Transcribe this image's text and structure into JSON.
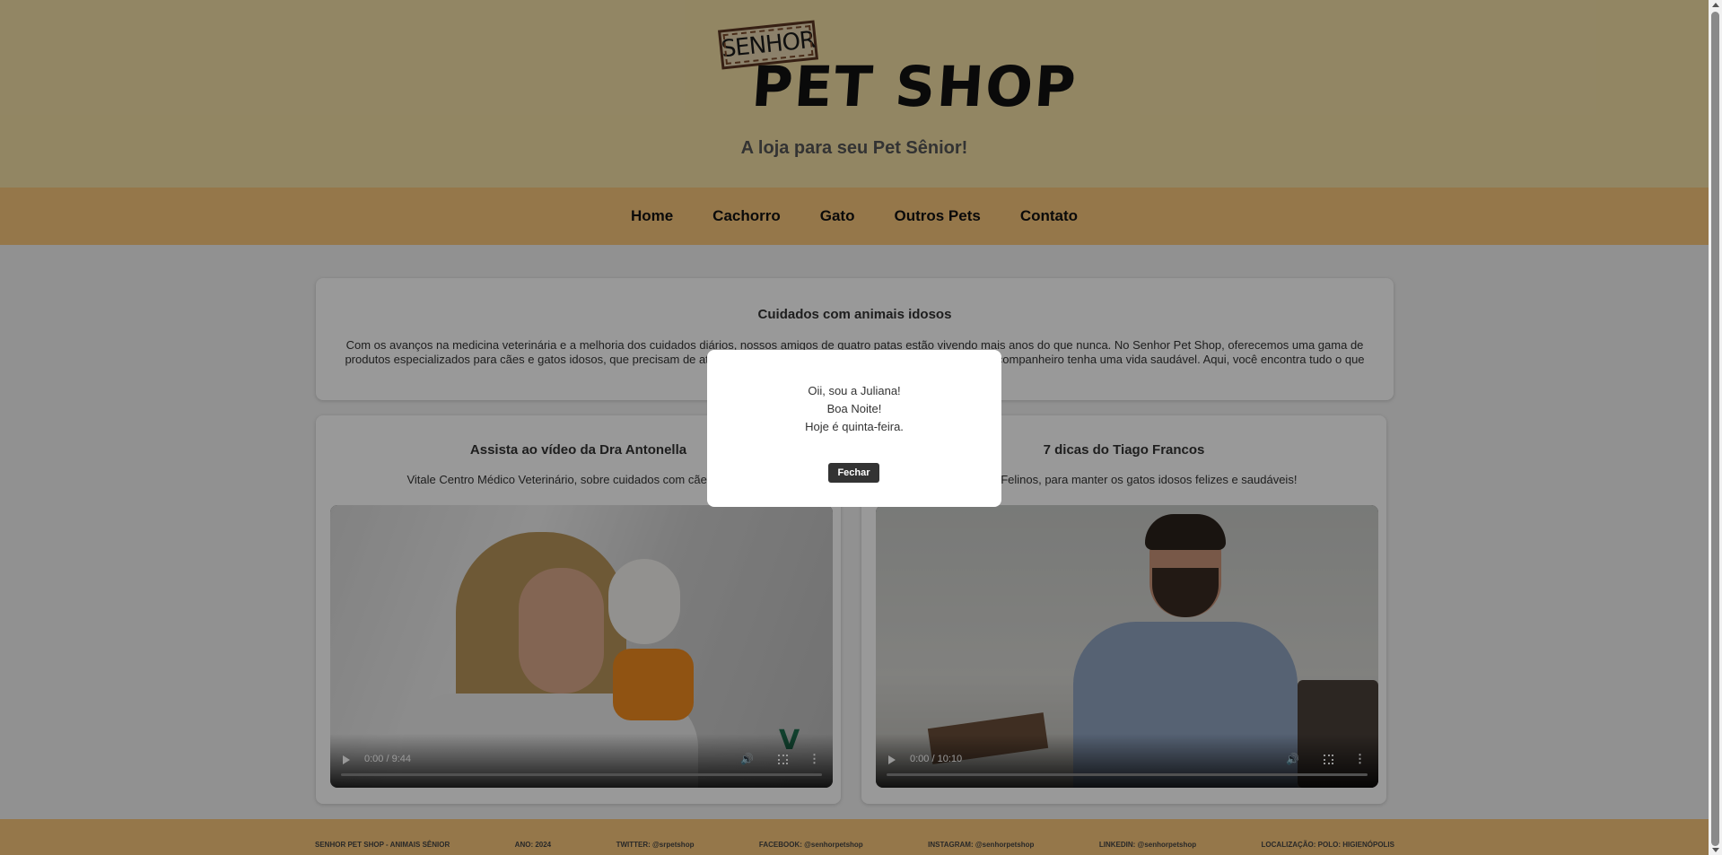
{
  "header": {
    "logo_small": "SENHOR",
    "logo_main": "PET SHOP",
    "tagline": "A loja para seu Pet Sênior!"
  },
  "nav": {
    "items": [
      "Home",
      "Cachorro",
      "Gato",
      "Outros Pets",
      "Contato"
    ]
  },
  "intro": {
    "title": "Cuidados com animais idosos",
    "text": "Com os avanços na medicina veterinária e a melhoria dos cuidados diários, nossos amigos de quatro patas estão vivendo mais anos do que nunca. No Senhor Pet Shop, oferecemos uma gama de produtos especializados para cães e gatos idosos, que precisam de atenção especial nessa fase da vida, garantindo que seu companheiro tenha uma vida saudável. Aqui, você encontra tudo o que seu pet sênior necessita para"
  },
  "videos": [
    {
      "title": "Assista ao vídeo da Dra Antonella",
      "subtitle": "Vitale Centro Médico Veterinário, sobre cuidados com cães idosos",
      "time": "0:00 / 9:44",
      "overlay_logo": "V"
    },
    {
      "title": "7 dicas do Tiago Francos",
      "subtitle": "Medicina Felinos, para manter os gatos idosos felizes e saudáveis!",
      "time": "0:00 / 10:10"
    }
  ],
  "footer": {
    "items": [
      "SENHOR PET SHOP - ANIMAIS SÊNIOR",
      "ANO: 2024",
      "TWITTER: @srpetshop",
      "FACEBOOK: @senhorpetshop",
      "INSTAGRAM: @senhorpetshop",
      "LINKEDIN: @senhorpetshop",
      "LOCALIZAÇÃO: POLO: HIGIENÓPOLIS"
    ]
  },
  "modal": {
    "line1": "Oii, sou a Juliana!",
    "line2": "Boa Noite!",
    "line3": "Hoje é quinta-feira.",
    "button": "Fechar"
  },
  "icons": {
    "play": "play-icon",
    "volume": "volume-icon",
    "fullscreen": "fullscreen-icon",
    "more": "more-options-icon"
  }
}
